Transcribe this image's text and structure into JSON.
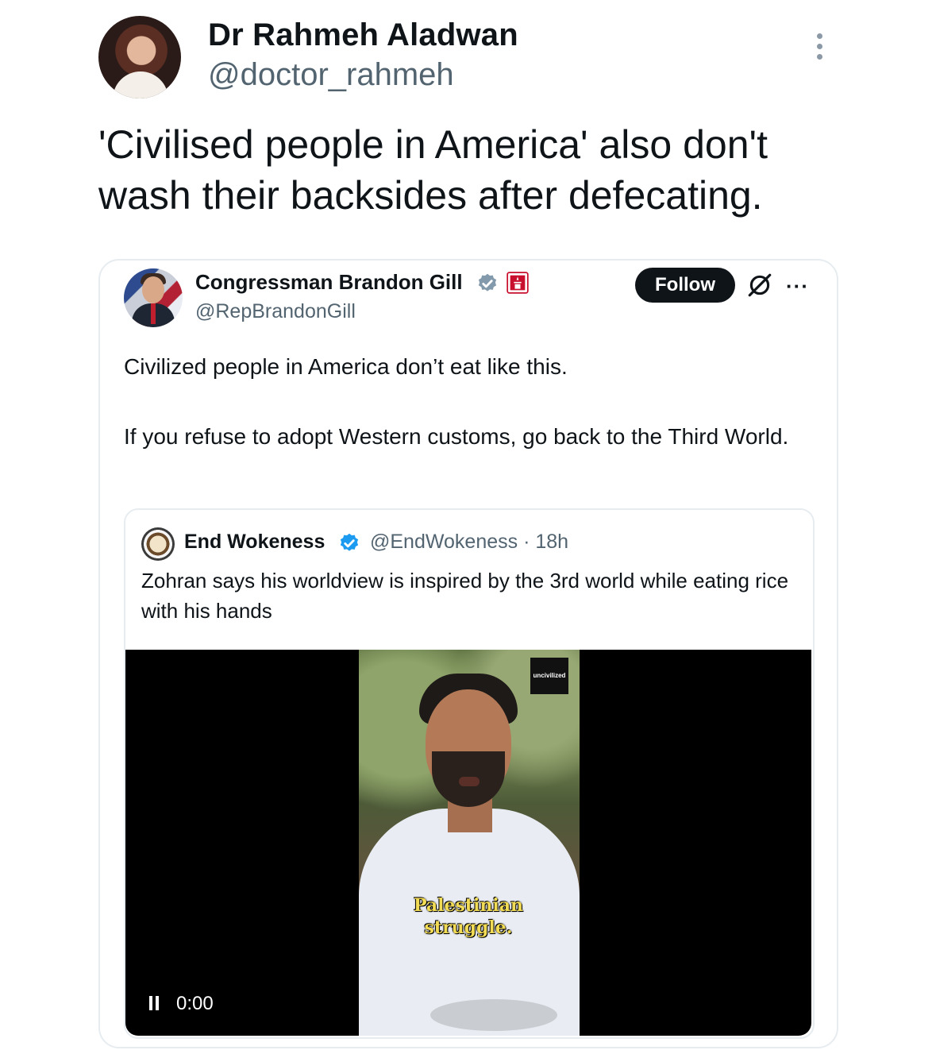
{
  "outer_tweet": {
    "display_name": "Dr Rahmeh Aladwan",
    "handle": "@doctor_rahmeh",
    "text": "'Civilised people in America' also don't wash their backsides after defecating."
  },
  "quoted_tweet": {
    "display_name": "Congressman Brandon Gill",
    "handle": "@RepBrandonGill",
    "follow_label": "Follow",
    "more_label": "···",
    "text_1": "Civilized people in America don’t eat like this.",
    "text_2": "If you refuse to adopt Western customs, go back to the Third World."
  },
  "nested_tweet": {
    "display_name": "End Wokeness",
    "handle_time": "@EndWokeness · 18h",
    "text": "Zohran says his worldview is inspired by the 3rd world while eating rice with his hands"
  },
  "video": {
    "watermark": "uncivilized",
    "caption": "Palestinian struggle.",
    "timestamp": "0:00"
  },
  "icons": [
    "more-vertical-icon",
    "verified-grey-icon",
    "flag-icon",
    "grok-icon",
    "more-horizontal-icon",
    "verified-blue-icon",
    "pause-icon"
  ],
  "colors": {
    "text": "#0f1419",
    "secondary": "#536471",
    "verified_blue": "#1d9bf0",
    "follow_bg": "#0f1419",
    "caption": "#f3dc55"
  }
}
